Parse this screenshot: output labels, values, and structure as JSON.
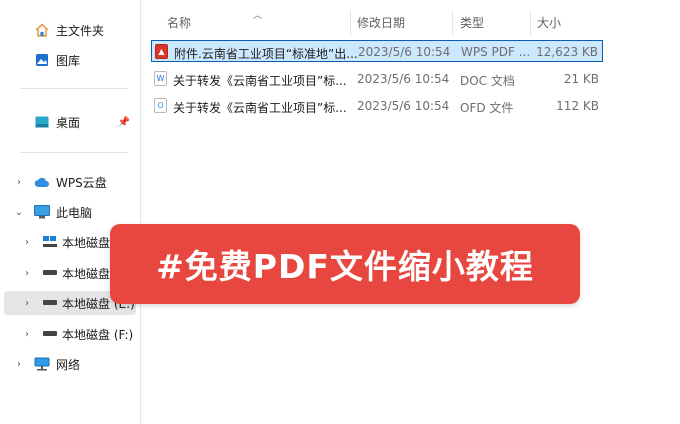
{
  "sidebar": {
    "items": [
      {
        "label": "主文件夹",
        "icon": "home-icon"
      },
      {
        "label": "图库",
        "icon": "gallery-icon"
      },
      {
        "label": "桌面",
        "icon": "desktop-icon",
        "pinned": true
      },
      {
        "label": "WPS云盘",
        "icon": "cloud-icon"
      },
      {
        "label": "此电脑",
        "icon": "computer-icon"
      },
      {
        "label": "本地磁盘",
        "icon": "drive-icon"
      },
      {
        "label": "本地磁盘",
        "icon": "drive-icon"
      },
      {
        "label": "本地磁盘 (E:)",
        "icon": "drive-icon",
        "selected": true
      },
      {
        "label": "本地磁盘 (F:)",
        "icon": "drive-icon"
      },
      {
        "label": "网络",
        "icon": "network-icon"
      }
    ]
  },
  "columns": {
    "name": "名称",
    "modified": "修改日期",
    "type": "类型",
    "size": "大小"
  },
  "files": [
    {
      "name": "附件.云南省工业项目“标准地”出...",
      "modified": "2023/5/6 10:54",
      "type": "WPS PDF ...",
      "size": "12,623 KB",
      "icon_color": "#d9362b",
      "selected": true
    },
    {
      "name": "关于转发《云南省工业项目”标...",
      "modified": "2023/5/6 10:54",
      "type": "DOC 文档",
      "size": "21 KB",
      "icon_color": "#2b6fd9",
      "selected": false
    },
    {
      "name": "关于转发《云南省工业项目”标...",
      "modified": "2023/5/6 10:54",
      "type": "OFD 文件",
      "size": "112 KB",
      "icon_color": "#2f8fe0",
      "selected": false
    }
  ],
  "banner": {
    "text": "#免费PDF文件缩小教程",
    "color": "#e8473f"
  }
}
